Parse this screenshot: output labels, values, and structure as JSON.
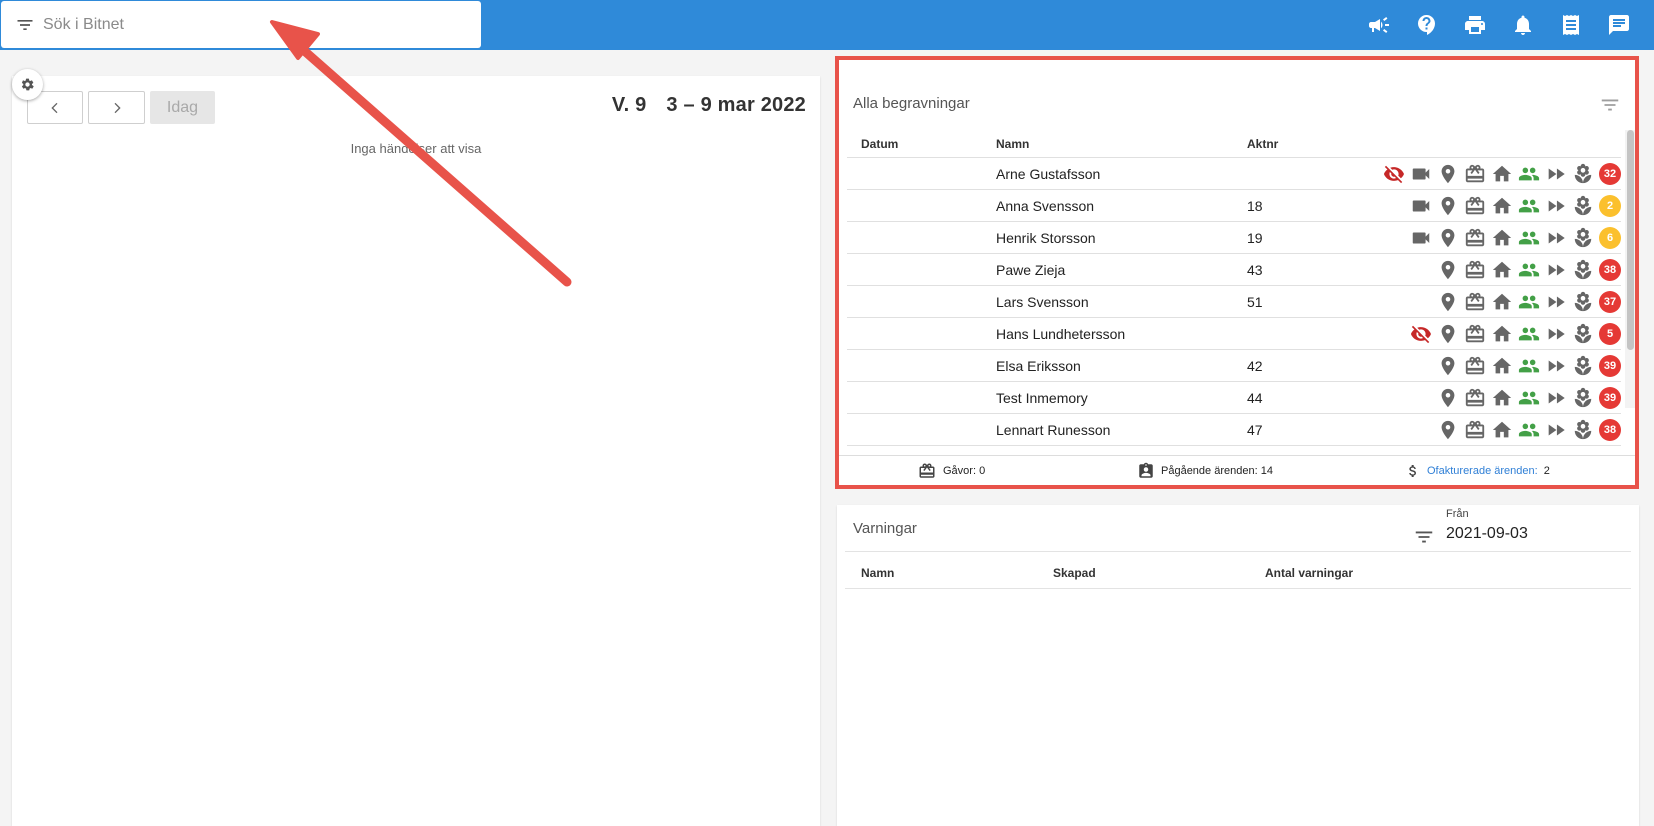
{
  "search": {
    "placeholder": "Sök i Bitnet"
  },
  "calendar": {
    "today_label": "Idag",
    "week": "V. 9",
    "range": "3 – 9 mar 2022",
    "empty": "Inga händelser att visa"
  },
  "funerals": {
    "title": "Alla begravningar",
    "columns": {
      "date": "Datum",
      "name": "Namn",
      "aktnr": "Aktnr"
    },
    "rows": [
      {
        "name": "Arne Gustafsson",
        "aktnr": "",
        "hidden": true,
        "video": true,
        "badge": "32",
        "badge_color": "red"
      },
      {
        "name": "Anna Svensson",
        "aktnr": "18",
        "hidden": false,
        "video": true,
        "badge": "2",
        "badge_color": "yellow"
      },
      {
        "name": "Henrik Storsson",
        "aktnr": "19",
        "hidden": false,
        "video": true,
        "badge": "6",
        "badge_color": "yellow"
      },
      {
        "name": "Pawe Zieja",
        "aktnr": "43",
        "hidden": false,
        "video": false,
        "badge": "38",
        "badge_color": "red"
      },
      {
        "name": "Lars Svensson",
        "aktnr": "51",
        "hidden": false,
        "video": false,
        "badge": "37",
        "badge_color": "red"
      },
      {
        "name": "Hans Lundhetersson",
        "aktnr": "",
        "hidden": true,
        "video": false,
        "badge": "5",
        "badge_color": "red"
      },
      {
        "name": "Elsa Eriksson",
        "aktnr": "42",
        "hidden": false,
        "video": false,
        "badge": "39",
        "badge_color": "red"
      },
      {
        "name": "Test Inmemory",
        "aktnr": "44",
        "hidden": false,
        "video": false,
        "badge": "39",
        "badge_color": "red"
      },
      {
        "name": "Lennart Runesson",
        "aktnr": "47",
        "hidden": false,
        "video": false,
        "badge": "38",
        "badge_color": "red"
      }
    ],
    "footer": {
      "gifts": "Gåvor: 0",
      "ongoing": "Pågående ärenden: 14",
      "uninvoiced_label": "Ofakturerade ärenden:",
      "uninvoiced_count": "2"
    }
  },
  "warnings": {
    "title": "Varningar",
    "from_label": "Från",
    "from_value": "2021-09-03",
    "columns": {
      "name": "Namn",
      "created": "Skapad",
      "count": "Antal varningar"
    }
  },
  "colors": {
    "topbar": "#2f8ad9",
    "accent_red": "#e8534a",
    "green": "#43a047",
    "badge_red": "#e53935",
    "badge_yellow": "#fbc02d"
  }
}
